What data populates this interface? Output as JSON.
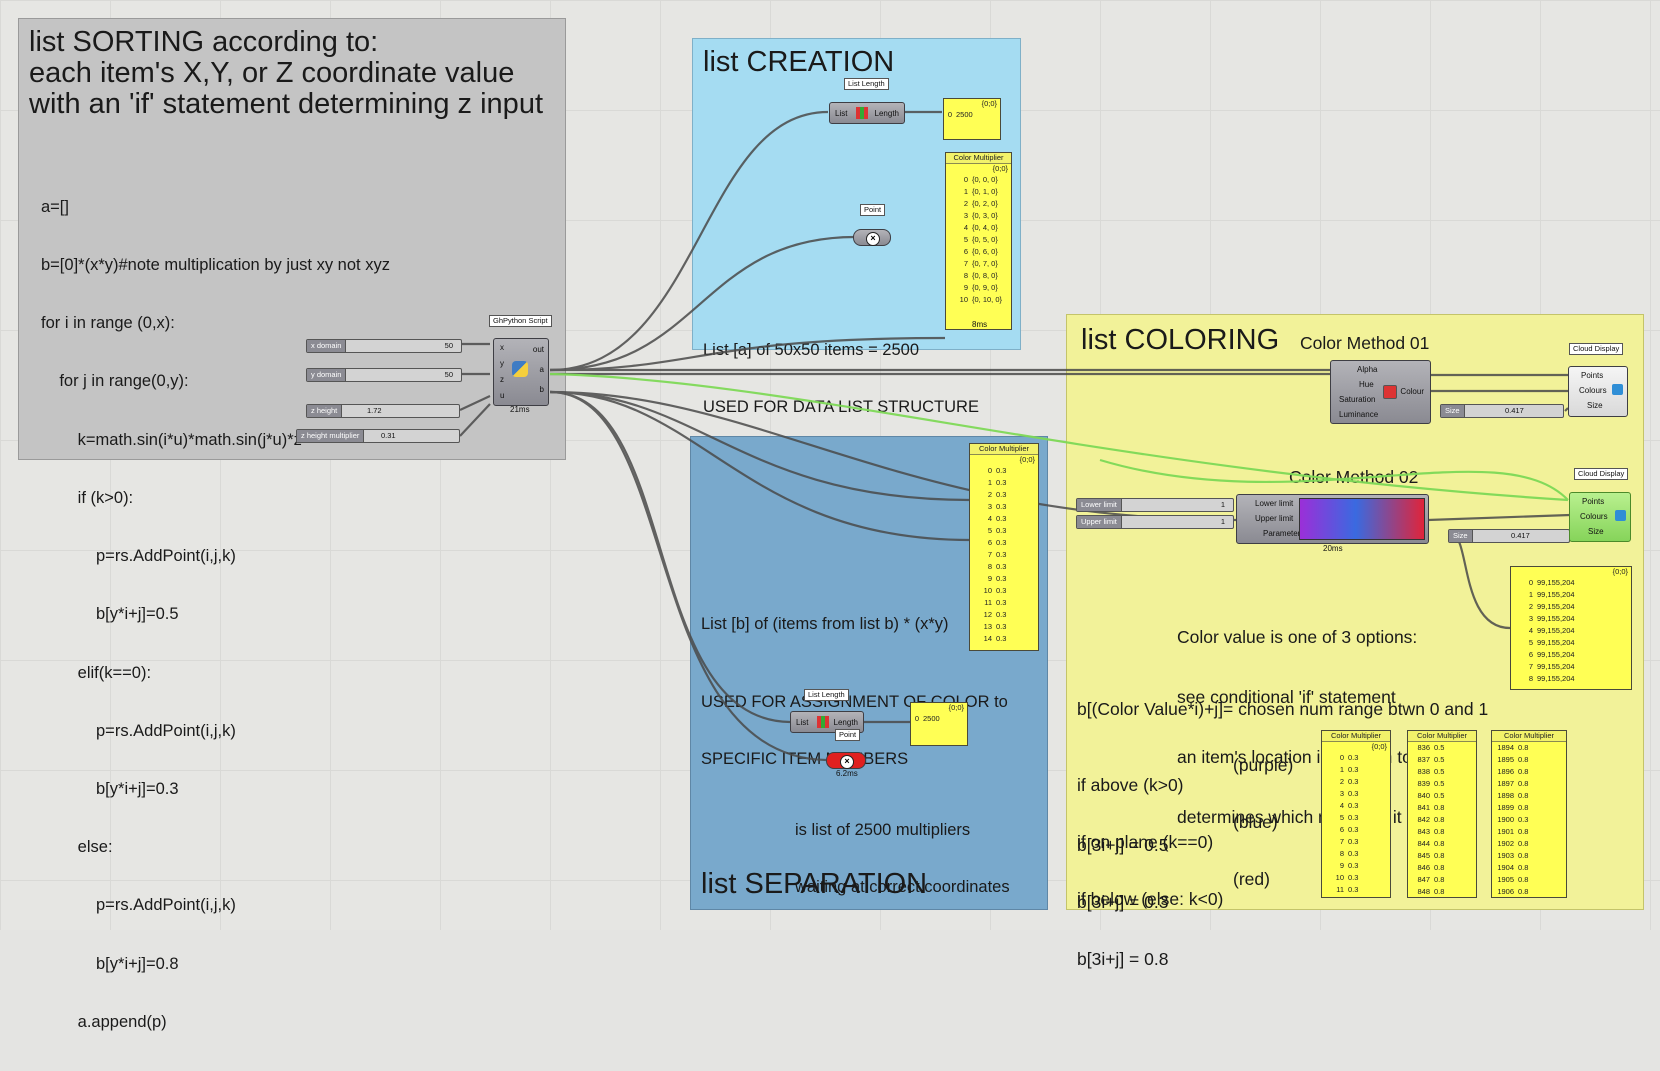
{
  "groups": {
    "sorting": {
      "title_lines": [
        "list SORTING according to:",
        "each item's X,Y, or Z coordinate value",
        "with an 'if' statement determining z input"
      ],
      "code_lines": [
        "a=[]",
        "b=[0]*(x*y)#note multiplication by just xy not xyz",
        "for i in range (0,x):",
        "    for j in range(0,y):",
        "        k=math.sin(i*u)*math.sin(j*u)*z",
        "        if (k>0):",
        "            p=rs.AddPoint(i,j,k)",
        "            b[y*i+j]=0.5",
        "        elif(k==0):",
        "            p=rs.AddPoint(i,j,k)",
        "            b[y*i+j]=0.3",
        "        else:",
        "            p=rs.AddPoint(i,j,k)",
        "            b[y*i+j]=0.8",
        "        a.append(p)"
      ],
      "color": "#c4c4c4"
    },
    "creation": {
      "title": "list CREATION",
      "note_lines": [
        "List [a] of 50x50 items = 2500",
        "USED FOR DATA LIST STRUCTURE"
      ],
      "color": "#a5dcf2"
    },
    "separation": {
      "title": "list SEPARATION",
      "note1": "List [b] of (items from list b) * (x*y)",
      "note2_lines": [
        "USED FOR ASSIGNMENT OF COLOR to",
        "SPECIFIC ITEM NUMBERS"
      ],
      "note3_lines": [
        "is list of 2500 multipliers",
        "waiting at correct coordinates"
      ],
      "color": "#79a9cc"
    },
    "coloring": {
      "title": "list COLORING",
      "method1": "Color Method 01",
      "method2": "Color Method 02",
      "note_lines": [
        "Color value is one of 3 options:",
        "see conditional 'if' statement",
        "an item's location in relation to  z=0",
        "determines which multiplier it receives"
      ],
      "formula": "b[(Color Value*i)+j]= chosen num range btwn 0 and 1",
      "cases": [
        {
          "cond": "if above (k>0)",
          "expr": "b[3i+j] = 0.5",
          "color_name": "(purple)"
        },
        {
          "cond": "if on plane (k==0)",
          "expr": "b[3i+j] = 0.3",
          "color_name": "(blue)"
        },
        {
          "cond": "if below (else: k<0)",
          "expr": "b[3i+j] = 0.8",
          "color_name": "(red)"
        }
      ],
      "color": "#f2f299"
    }
  },
  "components": {
    "python": {
      "tag": "GhPython Script",
      "inputs": [
        "x",
        "y",
        "z",
        "u"
      ],
      "outputs": [
        "out",
        "a",
        "b"
      ],
      "time": "21ms"
    },
    "list_length_1": {
      "tag": "List Length",
      "in": "List",
      "out": "Length"
    },
    "list_length_2": {
      "tag": "List Length",
      "in": "List",
      "out": "Length"
    },
    "point_1": {
      "tag": "Point"
    },
    "point_2": {
      "tag": "Point",
      "time": "6.2ms"
    },
    "colour_hsl": {
      "inputs": [
        "Alpha",
        "Hue",
        "Saturation",
        "Luminance"
      ],
      "out": "Colour"
    },
    "gradient": {
      "inputs": [
        "Lower limit",
        "Upper limit",
        "Parameter"
      ],
      "time": "20ms"
    },
    "cloud_1": {
      "tag": "Cloud Display",
      "inputs": [
        "Points",
        "Colours",
        "Size"
      ]
    },
    "cloud_2": {
      "tag": "Cloud Display",
      "inputs": [
        "Points",
        "Colours",
        "Size"
      ]
    }
  },
  "sliders": {
    "xdomain": {
      "name": "x domain",
      "value": "50"
    },
    "ydomain": {
      "name": "y domain",
      "value": "50"
    },
    "zheight": {
      "name": "z height",
      "value": "1.72"
    },
    "zmult": {
      "name": "z height multiplier",
      "value": "0.31"
    },
    "size1": {
      "name": "Size",
      "value": "0.417"
    },
    "size2": {
      "name": "Size",
      "value": "0.417"
    },
    "lower": {
      "name": "Lower limit",
      "value": "1"
    },
    "upper": {
      "name": "Upper limit",
      "value": "1"
    }
  },
  "panels": {
    "length_a": {
      "path": "{0;0}",
      "rows": [
        [
          "0",
          "2500"
        ]
      ]
    },
    "length_b": {
      "path": "{0;0}",
      "rows": [
        [
          "0",
          "2500"
        ]
      ]
    },
    "points": {
      "title": "Color Multiplier",
      "path": "{0;0}",
      "rows": [
        [
          "0",
          "{0, 0, 0}"
        ],
        [
          "1",
          "{0, 1, 0}"
        ],
        [
          "2",
          "{0, 2, 0}"
        ],
        [
          "3",
          "{0, 3, 0}"
        ],
        [
          "4",
          "{0, 4, 0}"
        ],
        [
          "5",
          "{0, 5, 0}"
        ],
        [
          "6",
          "{0, 6, 0}"
        ],
        [
          "7",
          "{0, 7, 0}"
        ],
        [
          "8",
          "{0, 8, 0}"
        ],
        [
          "9",
          "{0, 9, 0}"
        ],
        [
          "10",
          "{0, 10, 0}"
        ]
      ],
      "footer": "8ms"
    },
    "mult_b": {
      "title": "Color Multiplier",
      "path": "{0;0}",
      "rows": [
        [
          "0",
          "0.3"
        ],
        [
          "1",
          "0.3"
        ],
        [
          "2",
          "0.3"
        ],
        [
          "3",
          "0.3"
        ],
        [
          "4",
          "0.3"
        ],
        [
          "5",
          "0.3"
        ],
        [
          "6",
          "0.3"
        ],
        [
          "7",
          "0.3"
        ],
        [
          "8",
          "0.3"
        ],
        [
          "9",
          "0.3"
        ],
        [
          "10",
          "0.3"
        ],
        [
          "11",
          "0.3"
        ],
        [
          "12",
          "0.3"
        ],
        [
          "13",
          "0.3"
        ],
        [
          "14",
          "0.3"
        ]
      ]
    },
    "colours": {
      "path": "{0;0}",
      "rows": [
        [
          "0",
          "99,155,204"
        ],
        [
          "1",
          "99,155,204"
        ],
        [
          "2",
          "99,155,204"
        ],
        [
          "3",
          "99,155,204"
        ],
        [
          "4",
          "99,155,204"
        ],
        [
          "5",
          "99,155,204"
        ],
        [
          "6",
          "99,155,204"
        ],
        [
          "7",
          "99,155,204"
        ],
        [
          "8",
          "99,155,204"
        ]
      ]
    },
    "cm1": {
      "title": "Color Multiplier",
      "path": "{0;0}",
      "rows": [
        [
          "0",
          "0.3"
        ],
        [
          "1",
          "0.3"
        ],
        [
          "2",
          "0.3"
        ],
        [
          "3",
          "0.3"
        ],
        [
          "4",
          "0.3"
        ],
        [
          "5",
          "0.3"
        ],
        [
          "6",
          "0.3"
        ],
        [
          "7",
          "0.3"
        ],
        [
          "8",
          "0.3"
        ],
        [
          "9",
          "0.3"
        ],
        [
          "10",
          "0.3"
        ],
        [
          "11",
          "0.3"
        ]
      ]
    },
    "cm2": {
      "title": "Color Multiplier",
      "path": "",
      "rows": [
        [
          "836",
          "0.5"
        ],
        [
          "837",
          "0.5"
        ],
        [
          "838",
          "0.5"
        ],
        [
          "839",
          "0.5"
        ],
        [
          "840",
          "0.5"
        ],
        [
          "841",
          "0.8"
        ],
        [
          "842",
          "0.8"
        ],
        [
          "843",
          "0.8"
        ],
        [
          "844",
          "0.8"
        ],
        [
          "845",
          "0.8"
        ],
        [
          "846",
          "0.8"
        ],
        [
          "847",
          "0.8"
        ],
        [
          "848",
          "0.8"
        ]
      ]
    },
    "cm3": {
      "title": "Color Multiplier",
      "path": "",
      "rows": [
        [
          "1894",
          "0.8"
        ],
        [
          "1895",
          "0.8"
        ],
        [
          "1896",
          "0.8"
        ],
        [
          "1897",
          "0.8"
        ],
        [
          "1898",
          "0.8"
        ],
        [
          "1899",
          "0.8"
        ],
        [
          "1900",
          "0.3"
        ],
        [
          "1901",
          "0.8"
        ],
        [
          "1902",
          "0.8"
        ],
        [
          "1903",
          "0.8"
        ],
        [
          "1904",
          "0.8"
        ],
        [
          "1905",
          "0.8"
        ],
        [
          "1906",
          "0.8"
        ]
      ]
    }
  },
  "colors": {
    "wire": "#4a4a4a",
    "wire_selected": "#7ed957",
    "panel": "#ffff55"
  }
}
